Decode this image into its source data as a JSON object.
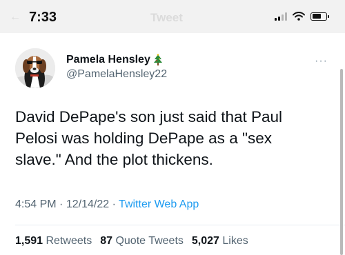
{
  "status_bar": {
    "time": "7:33"
  },
  "header": {
    "title": "Tweet"
  },
  "tweet": {
    "author_name": "Pamela Hensley",
    "author_handle": "@PamelaHensley22",
    "text": "David DePape's son just said that Paul Pelosi was holding DePape as a \"sex slave.\" And the plot thickens.",
    "time": "4:54 PM",
    "date": "12/14/22",
    "source": "Twitter Web App",
    "separator": "·",
    "more_label": "···"
  },
  "stats": {
    "retweets_count": "1,591",
    "retweets_label": "Retweets",
    "quotes_count": "87",
    "quotes_label": "Quote Tweets",
    "likes_count": "5,027",
    "likes_label": "Likes"
  }
}
